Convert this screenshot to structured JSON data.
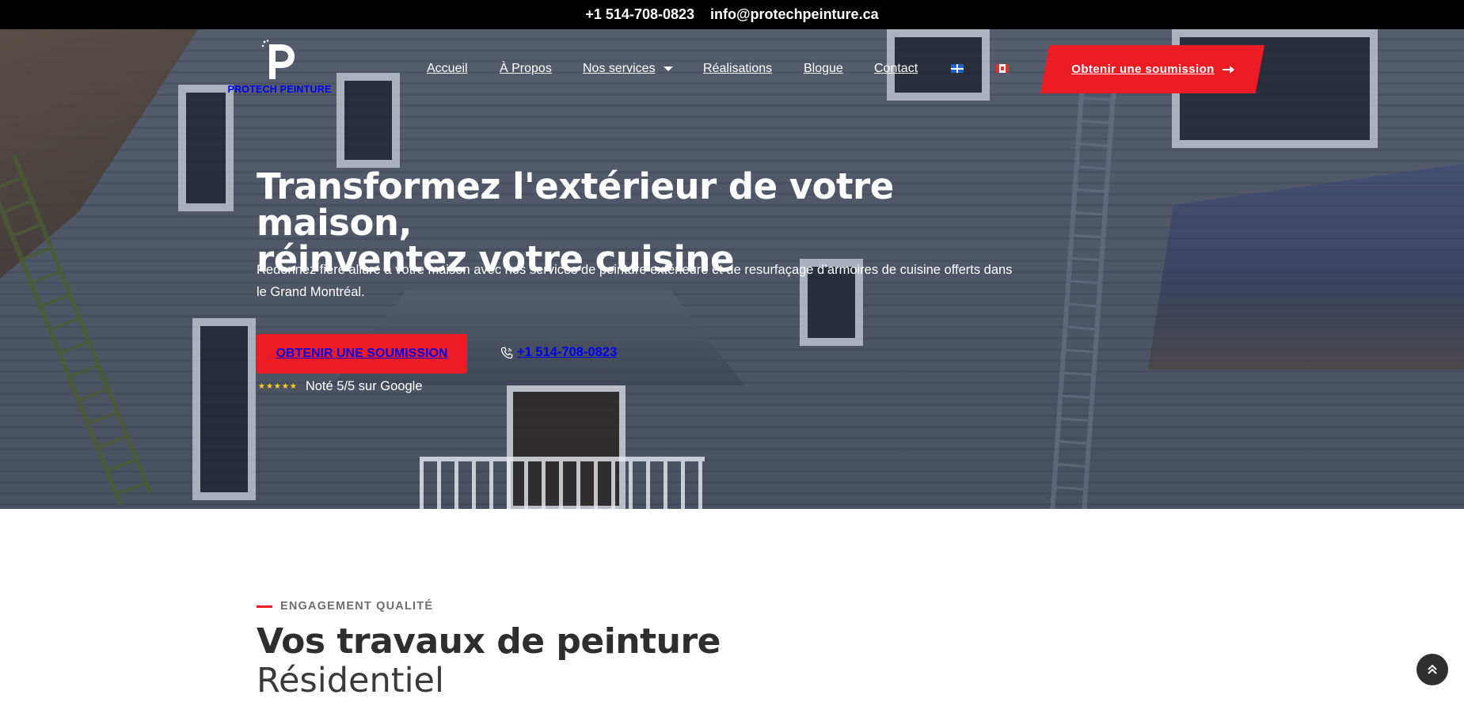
{
  "topbar": {
    "phone": "+1 514-708-0823",
    "email": "info@protechpeinture.ca"
  },
  "brand": {
    "name": "PROTECH PEINTURE"
  },
  "nav": {
    "items": [
      {
        "label": "Accueil"
      },
      {
        "label": "À Propos"
      },
      {
        "label": "Nos services"
      },
      {
        "label": "Réalisations"
      },
      {
        "label": "Blogue"
      },
      {
        "label": "Contact"
      }
    ],
    "languages": [
      "quebec-flag-icon",
      "canada-flag-icon"
    ],
    "cta_label": "Obtenir une soumission"
  },
  "hero": {
    "title_line1": "Transformez l'extérieur de votre maison,",
    "title_line2": "réinventez votre cuisine",
    "subtitle": "Redonnez fière allure à votre maison avec nos services de peinture extérieure et de resurfaçage d’armoires de cuisine offerts dans le Grand Montréal.",
    "cta_label": "OBTENIR UNE SOUMISSION",
    "phone": "+1 514-708-0823",
    "stars": "★★★★★",
    "rating_text": "Noté 5/5 sur Google"
  },
  "section": {
    "kicker": "ENGAGEMENT QUALITÉ",
    "title": "Vos travaux de peinture",
    "subtitle": "Résidentiel"
  },
  "colors": {
    "accent": "#ed1c24",
    "topbar_bg": "#000000",
    "star": "#ffd21a"
  }
}
